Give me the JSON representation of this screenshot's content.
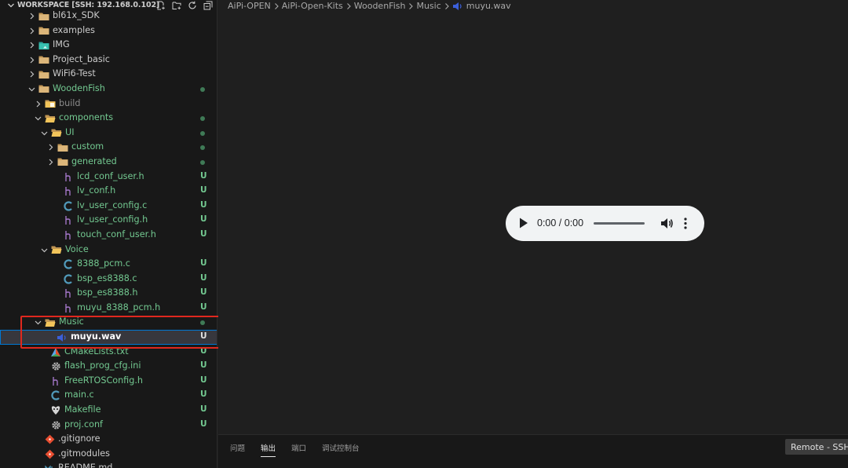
{
  "explorer": {
    "workspace_title": "WORKSPACE [SSH: 192.168.0.102]",
    "actions": [
      "new-file-icon",
      "new-folder-icon",
      "refresh-icon",
      "collapse-all-icon"
    ],
    "items": [
      {
        "label": "bl61x_SDK",
        "type": "folder",
        "depth": 0,
        "expanded": false,
        "color": "white",
        "status": ""
      },
      {
        "label": "examples",
        "type": "folder",
        "depth": 0,
        "expanded": false,
        "color": "white",
        "status": ""
      },
      {
        "label": "IMG",
        "type": "folder-img",
        "depth": 0,
        "expanded": false,
        "color": "white",
        "status": ""
      },
      {
        "label": "Project_basic",
        "type": "folder",
        "depth": 0,
        "expanded": false,
        "color": "white",
        "status": ""
      },
      {
        "label": "WiFi6-Test",
        "type": "folder",
        "depth": 0,
        "expanded": false,
        "color": "white",
        "status": ""
      },
      {
        "label": "WoodenFish",
        "type": "folder",
        "depth": 0,
        "expanded": true,
        "color": "green",
        "status": "dot"
      },
      {
        "label": "build",
        "type": "folder-build",
        "depth": 1,
        "expanded": false,
        "color": "gray",
        "status": ""
      },
      {
        "label": "components",
        "type": "folder-yellow",
        "depth": 1,
        "expanded": true,
        "color": "green",
        "status": "dot"
      },
      {
        "label": "UI",
        "type": "folder-yellow",
        "depth": 2,
        "expanded": true,
        "color": "green",
        "status": "dot"
      },
      {
        "label": "custom",
        "type": "folder",
        "depth": 3,
        "expanded": false,
        "color": "green",
        "status": "dot"
      },
      {
        "label": "generated",
        "type": "folder",
        "depth": 3,
        "expanded": false,
        "color": "green",
        "status": "dot"
      },
      {
        "label": "lcd_conf_user.h",
        "type": "h",
        "depth": 3,
        "color": "green",
        "status": "U"
      },
      {
        "label": "lv_conf.h",
        "type": "h",
        "depth": 3,
        "color": "green",
        "status": "U"
      },
      {
        "label": "lv_user_config.c",
        "type": "c",
        "depth": 3,
        "color": "green",
        "status": "U"
      },
      {
        "label": "lv_user_config.h",
        "type": "h",
        "depth": 3,
        "color": "green",
        "status": "U"
      },
      {
        "label": "touch_conf_user.h",
        "type": "h",
        "depth": 3,
        "color": "green",
        "status": "U"
      },
      {
        "label": "Voice",
        "type": "folder-yellow",
        "depth": 2,
        "expanded": true,
        "color": "green",
        "status": ""
      },
      {
        "label": "8388_pcm.c",
        "type": "c",
        "depth": 3,
        "color": "green",
        "status": "U"
      },
      {
        "label": "bsp_es8388.c",
        "type": "c",
        "depth": 3,
        "color": "green",
        "status": "U"
      },
      {
        "label": "bsp_es8388.h",
        "type": "h",
        "depth": 3,
        "color": "green",
        "status": "U"
      },
      {
        "label": "muyu_8388_pcm.h",
        "type": "h",
        "depth": 3,
        "color": "green",
        "status": "U"
      },
      {
        "label": "Music",
        "type": "folder-yellow",
        "depth": 1,
        "expanded": true,
        "color": "green",
        "status": "dot"
      },
      {
        "label": "muyu.wav",
        "type": "wav",
        "depth": 2,
        "color": "white",
        "status": "U",
        "selected": true
      },
      {
        "label": "CMakeLists.txt",
        "type": "cmake",
        "depth": 1,
        "color": "green",
        "status": "U"
      },
      {
        "label": "flash_prog_cfg.ini",
        "type": "gear",
        "depth": 1,
        "color": "green",
        "status": "U"
      },
      {
        "label": "FreeRTOSConfig.h",
        "type": "h",
        "depth": 1,
        "color": "green",
        "status": "U"
      },
      {
        "label": "main.c",
        "type": "c",
        "depth": 1,
        "color": "green",
        "status": "U"
      },
      {
        "label": "Makefile",
        "type": "makefile",
        "depth": 1,
        "color": "green",
        "status": "U"
      },
      {
        "label": "proj.conf",
        "type": "gear",
        "depth": 1,
        "color": "green",
        "status": "U"
      },
      {
        "label": ".gitignore",
        "type": "git",
        "depth": 0,
        "color": "white",
        "status": ""
      },
      {
        "label": ".gitmodules",
        "type": "git",
        "depth": 0,
        "color": "white",
        "status": ""
      },
      {
        "label": "README.md",
        "type": "md",
        "depth": 0,
        "color": "white",
        "status": ""
      }
    ]
  },
  "breadcrumbs": [
    "AiPi-OPEN",
    "AiPi-Open-Kits",
    "WoodenFish",
    "Music",
    "muyu.wav"
  ],
  "audio_player": {
    "time": "0:00 / 0:00",
    "progress": 0
  },
  "panel": {
    "tabs": [
      {
        "label": "问题",
        "active": false
      },
      {
        "label": "输出",
        "active": true
      },
      {
        "label": "端口",
        "active": false
      },
      {
        "label": "调试控制台",
        "active": false
      }
    ]
  },
  "remote_badge": "Remote - SSH",
  "colors": {
    "green": "#73c991",
    "folder_yellow": "#dcb67a",
    "c_blue": "#519aba",
    "highlight_red": "#e0281e"
  }
}
